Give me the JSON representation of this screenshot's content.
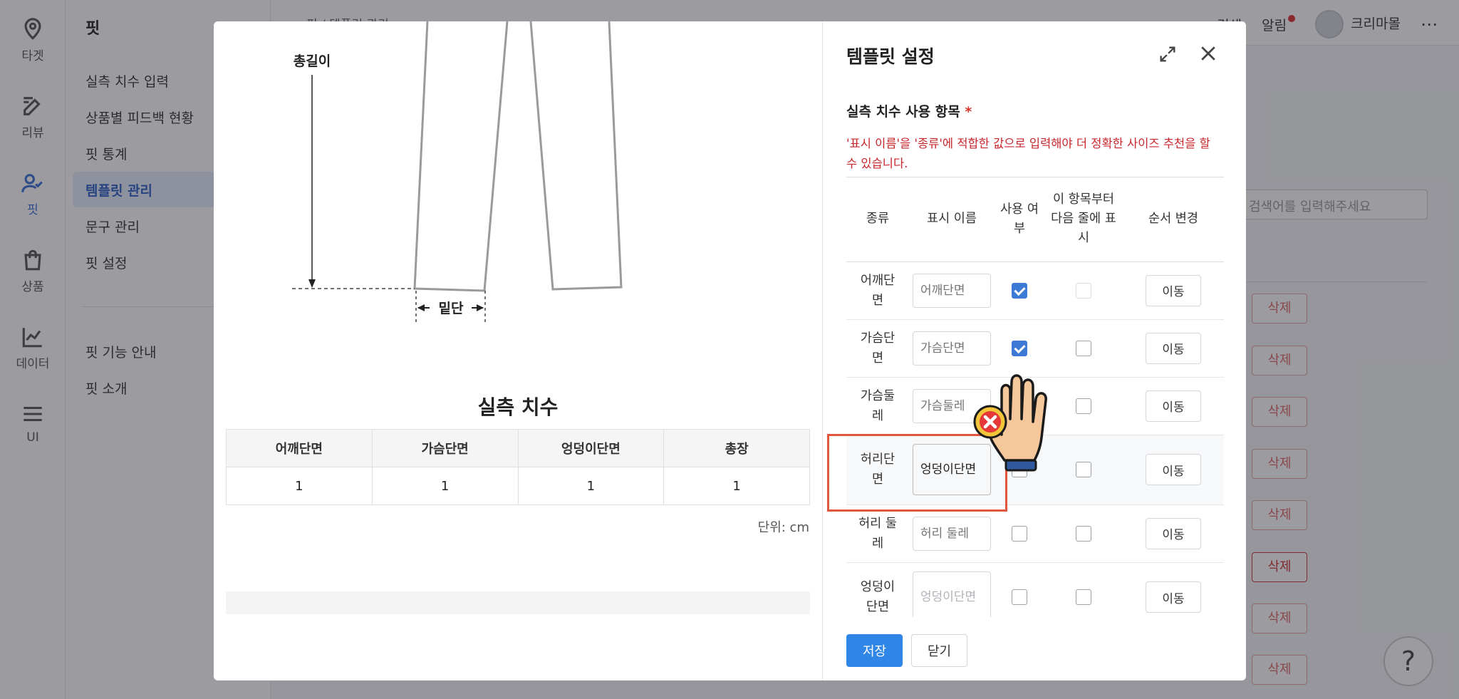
{
  "rail": [
    {
      "label": "타겟",
      "icon": "location-pin-icon"
    },
    {
      "label": "리뷰",
      "icon": "edit-icon"
    },
    {
      "label": "핏",
      "icon": "user-check-icon",
      "active": true
    },
    {
      "label": "상품",
      "icon": "shopping-bag-icon"
    },
    {
      "label": "데이터",
      "icon": "line-chart-icon"
    },
    {
      "label": "UI",
      "icon": "menu-icon"
    }
  ],
  "subnav": {
    "title": "핏",
    "items": [
      "실측 치수 입력",
      "상품별 피드백 현황",
      "핏 통계",
      "템플릿 관리",
      "문구 관리",
      "핏 설정"
    ],
    "active_index": 3,
    "extra_items": [
      "핏 기능 안내",
      "핏 소개"
    ]
  },
  "topbar": {
    "breadcrumb": "핏 / 템플릿 관리",
    "search": "검색",
    "notifications": "알림",
    "user": "크리마몰",
    "more": "⋯"
  },
  "background": {
    "search_placeholder": "검색어를 입력해주세요",
    "delete_label": "삭제",
    "help": "?"
  },
  "preview": {
    "labels": {
      "total_length": "총길이",
      "hem": "밑단"
    },
    "measure_title": "실측 치수",
    "columns": [
      "어깨단면",
      "가슴단면",
      "엉덩이단면",
      "총장"
    ],
    "values": [
      "1",
      "1",
      "1",
      "1"
    ],
    "unit": "단위: cm"
  },
  "panel": {
    "title": "템플릿 설정",
    "section_label": "실측 치수 사용 항목",
    "required_mark": "*",
    "warning": "'표시 이름'을 '종류'에 적합한 값으로 입력해야 더 정확한 사이즈 추천을 할 수 있습니다.",
    "headers": {
      "kind": "종류",
      "display_name": "표시 이름",
      "use": "사용 여부",
      "newline": "이 항목부터 다음 줄에 표시",
      "order": "순서 변경"
    },
    "rows": [
      {
        "kind": "어깨단면",
        "placeholder": "어깨단면",
        "value": "",
        "use": true,
        "newline": false
      },
      {
        "kind": "가슴단면",
        "placeholder": "가슴단면",
        "value": "",
        "use": true,
        "newline": false
      },
      {
        "kind": "가슴둘레",
        "placeholder": "가슴둘레",
        "value": "",
        "use": false,
        "newline": false
      },
      {
        "kind": "허리단면",
        "placeholder": "허리단면",
        "value": "엉덩이단면",
        "use": false,
        "newline": false
      },
      {
        "kind": "허리 둘레",
        "placeholder": "허리 둘레",
        "value": "",
        "use": false,
        "newline": false
      },
      {
        "kind": "엉덩이단면",
        "placeholder": "엉덩이단면",
        "value": "",
        "use": false,
        "newline": false
      }
    ],
    "move_label": "이동",
    "save": "저장",
    "close": "닫기"
  }
}
